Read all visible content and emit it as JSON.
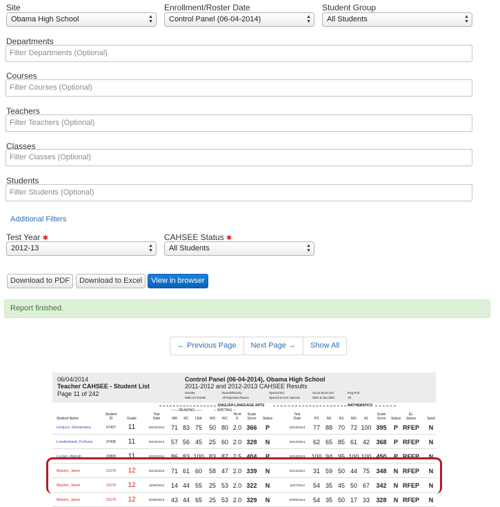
{
  "filters": {
    "site": {
      "label": "Site",
      "value": "Obama High School"
    },
    "enrollment": {
      "label": "Enrollment/Roster Date",
      "value": "Control Panel (06-04-2014)"
    },
    "student_group": {
      "label": "Student Group",
      "value": "All Students"
    },
    "departments": {
      "label": "Departments",
      "placeholder": "Filter Departments (Optional)"
    },
    "courses": {
      "label": "Courses",
      "placeholder": "Filter Courses (Optional)"
    },
    "teachers": {
      "label": "Teachers",
      "placeholder": "Filter Teachers (Optional)"
    },
    "classes": {
      "label": "Classes",
      "placeholder": "Filter Classes (Optional)"
    },
    "students": {
      "label": "Students",
      "placeholder": "Filter Students (Optional)"
    },
    "additional": "Additional Filters",
    "test_year": {
      "label": "Test Year",
      "value": "2012-13"
    },
    "cahsee_status": {
      "label": "CAHSEE Status",
      "value": "All Students"
    },
    "required_mark": "✱"
  },
  "actions": {
    "pdf": "Download to PDF",
    "excel": "Download to Excel",
    "browser": "View in browser"
  },
  "alert": "Report finished.",
  "pager": {
    "prev": "← Previous Page",
    "next": "Next Page →",
    "all": "Show All"
  },
  "colors": {
    "accent": "#0b61b8",
    "alert_bg": "#dff0d8",
    "alert_text": "#3c763d",
    "highlight": "#b01a24",
    "link": "#2f6eb5"
  },
  "report": {
    "date": "06/04/2014",
    "title": "Teacher CAHSEE - Student List",
    "page": "Page 11  of 242",
    "panel": "Control Panel (06-04-2014), Obama High School",
    "subtitle": "2011-2012 and 2012-2013 CAHSEE Results",
    "gender_h": "Gender",
    "gender_v": "Male & Female",
    "race_h": "Race/Ethnicity",
    "race_v": "All Reported Races",
    "sped_h": "Special Ed.",
    "sped_v": "Special & Non Special",
    "ses_h": "Socio-Econ Dis.",
    "ses_v": "SED & Not SED",
    "eng_h": "Eng Prof",
    "eng_v": "All",
    "ela": "ENGLISH-LANGUAGE ARTS",
    "math": "MATHEMATICS",
    "reading": "------ READING ------",
    "writing": "-- WRITING --",
    "col": {
      "name": "Student Name",
      "sid1": "Student",
      "sid2": "ID",
      "grade": "Grade",
      "td1": "Test",
      "td2": "Date",
      "wa": "WA",
      "rc": "RC",
      "lra": "LRA",
      "ws": "WS",
      "wc": "WC",
      "wra1": "W+A",
      "e": "E",
      "sc1": "Scale",
      "sc2": "Score",
      "status": "Status",
      "mtd1": "Test",
      "mtd2": "Date",
      "ps": "PS",
      "ns": "NS",
      "as": "AS",
      "mg": "MG",
      "a1": "A1",
      "msc1": "Scale",
      "msc2": "Score",
      "mstatus": "Status",
      "el1": "EL",
      "el2": "Status",
      "sped": "Sped"
    },
    "rows": [
      {
        "name": "Limjuco, Gelzamany",
        "id": "97437",
        "grade": "11",
        "date": "03/12/2013",
        "wa": "71",
        "rc": "83",
        "lra": "75",
        "ws": "50",
        "wc": "80",
        "e": "2.0",
        "score": "366",
        "status": "P",
        "mdate": "03/13/2013",
        "ps": "77",
        "ns": "88",
        "as": "70",
        "mg": "72",
        "a1": "100",
        "mscore": "395",
        "mstatus": "P",
        "el": "RFEP",
        "sped": "N"
      },
      {
        "name": "Loudenback, Fortuna",
        "id": "97438",
        "grade": "11",
        "date": "03/12/2013",
        "wa": "57",
        "rc": "56",
        "lra": "45",
        "ws": "25",
        "wc": "60",
        "e": "2.0",
        "score": "328",
        "status": "N",
        "mdate": "03/13/2013",
        "ps": "62",
        "ns": "65",
        "as": "85",
        "mg": "61",
        "a1": "42",
        "mscore": "368",
        "mstatus": "P",
        "el": "RFEP",
        "sped": "N"
      },
      {
        "name": "Lucian, Alanah",
        "id": "29808",
        "grade": "11",
        "date": "03/12/2013",
        "wa": "86",
        "rc": "83",
        "lra": "100",
        "ws": "83",
        "wc": "87",
        "e": "2.5",
        "score": "404",
        "status": "P",
        "mdate": "03/13/2013",
        "ps": "100",
        "ns": "94",
        "as": "95",
        "mg": "100",
        "a1": "100",
        "mscore": "450",
        "mstatus": "P",
        "el": "RFEP",
        "sped": "N"
      },
      {
        "name": "Mackin, Janet",
        "id": "20178",
        "grade": "12",
        "date": "03/12/2013",
        "wa": "71",
        "rc": "61",
        "lra": "60",
        "ws": "58",
        "wc": "47",
        "e": "2.0",
        "score": "339",
        "status": "N",
        "mdate": "03/14/2012",
        "ps": "31",
        "ns": "59",
        "as": "50",
        "mg": "44",
        "a1": "75",
        "mscore": "348",
        "mstatus": "N",
        "el": "RFEP",
        "sped": "N"
      },
      {
        "name": "Mackin, Janet",
        "id": "20178",
        "grade": "12",
        "date": "11/06/2012",
        "wa": "14",
        "rc": "44",
        "lra": "55",
        "ws": "25",
        "wc": "53",
        "e": "2.0",
        "score": "322",
        "status": "N",
        "mdate": "11/07/2012",
        "ps": "54",
        "ns": "35",
        "as": "45",
        "mg": "50",
        "a1": "67",
        "mscore": "342",
        "mstatus": "N",
        "el": "RFEP",
        "sped": "N"
      },
      {
        "name": "Mackin, Janet",
        "id": "20178",
        "grade": "12",
        "date": "02/05/2013",
        "wa": "43",
        "rc": "44",
        "lra": "65",
        "ws": "25",
        "wc": "53",
        "e": "2.0",
        "score": "329",
        "status": "N",
        "mdate": "02/06/2013",
        "ps": "54",
        "ns": "35",
        "as": "50",
        "mg": "17",
        "a1": "33",
        "mscore": "328",
        "mstatus": "N",
        "el": "RFEP",
        "sped": "N"
      }
    ]
  }
}
